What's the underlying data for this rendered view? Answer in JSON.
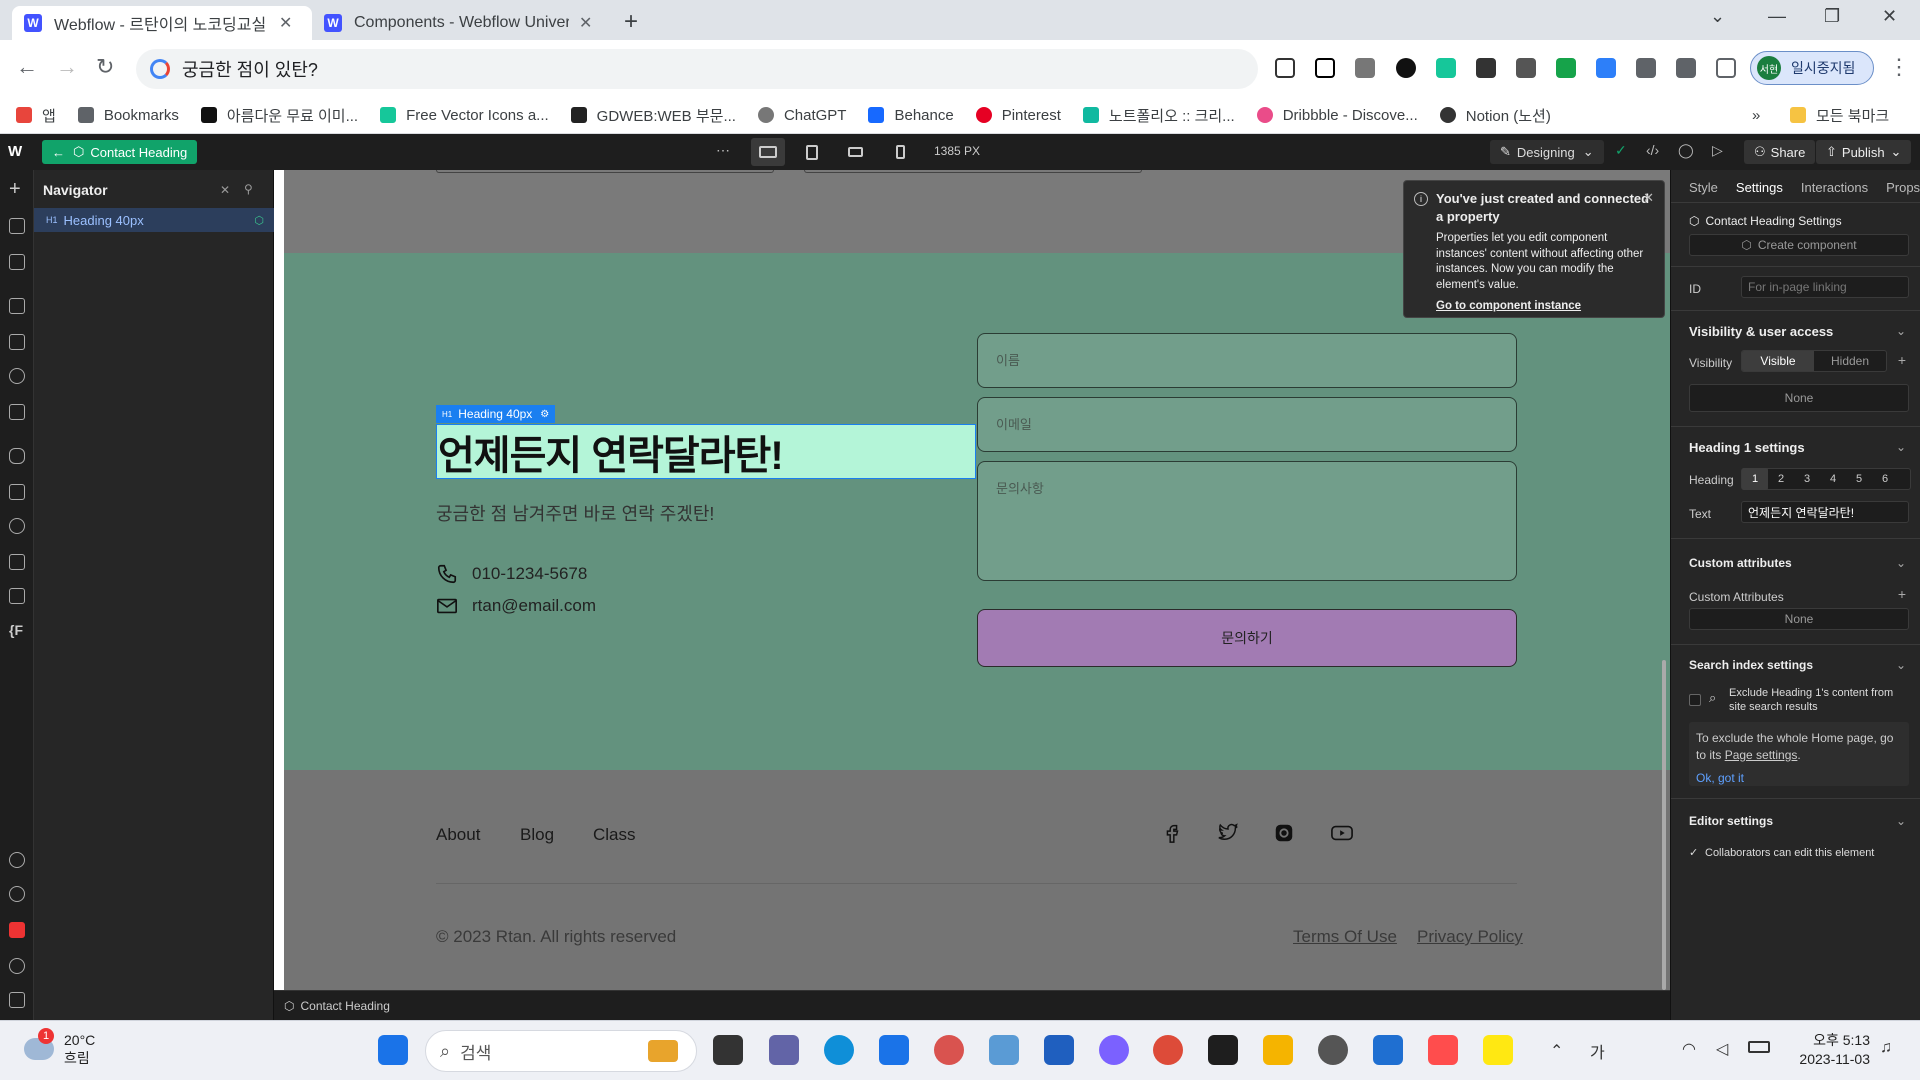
{
  "browser": {
    "tabs": [
      {
        "title": "Webflow - 르탄이의 노코딩교실",
        "active": true
      },
      {
        "title": "Components - Webflow Univer",
        "active": false
      }
    ],
    "address": "궁금한 점이 있탄?",
    "profile_label": "일시중지됨",
    "profile_avatar": "서현",
    "bookmarks": [
      {
        "label": "앱",
        "color": "#e8453c"
      },
      {
        "label": "Bookmarks",
        "color": "#5f6368"
      },
      {
        "label": "아름다운 무료 이미...",
        "color": "#111111"
      },
      {
        "label": "Free Vector Icons a...",
        "color": "#16c79a"
      },
      {
        "label": "GDWEB:WEB 부문...",
        "color": "#222222"
      },
      {
        "label": "ChatGPT",
        "color": "#777777"
      },
      {
        "label": "Behance",
        "color": "#1769ff"
      },
      {
        "label": "Pinterest",
        "color": "#e60023"
      },
      {
        "label": "노트폴리오 :: 크리...",
        "color": "#10b9a0"
      },
      {
        "label": "Dribbble - Discove...",
        "color": "#ea4c89"
      },
      {
        "label": "Notion (노션)",
        "color": "#333333"
      }
    ],
    "all_bookmarks": "모든 북마크"
  },
  "webflow": {
    "breadcrumb": "Contact Heading",
    "width_label": "1385 PX",
    "mode": "Designing",
    "share": "Share",
    "publish": "Publish",
    "navigator": {
      "title": "Navigator",
      "item_tag": "H1",
      "item_label": "Heading 40px"
    },
    "status_crumb": "Contact Heading"
  },
  "page": {
    "badge_tag": "H1",
    "badge_label": "Heading 40px",
    "heading": "언제든지 연락달라탄!",
    "subheading": "궁금한 점 남겨주면 바로 연락 주겠탄!",
    "phone": "010-1234-5678",
    "email": "rtan@email.com",
    "form": {
      "name_placeholder": "이름",
      "email_placeholder": "이메일",
      "message_placeholder": "문의사항",
      "submit": "문의하기"
    },
    "footer": {
      "links": [
        "About",
        "Blog",
        "Class"
      ],
      "copyright": "© 2023 Rtan. All rights reserved",
      "terms": "Terms Of Use",
      "privacy": "Privacy Policy"
    }
  },
  "popover": {
    "title": "You've just created and connected a property",
    "body": "Properties let you edit component instances' content without affecting other instances. Now you can modify the element's value.",
    "link": "Go to component instance"
  },
  "panel": {
    "tabs": [
      "Style",
      "Settings",
      "Interactions",
      "Props"
    ],
    "active_tab": "Settings",
    "settings_title": "Contact Heading Settings",
    "create_component": "Create component",
    "id_label": "ID",
    "id_placeholder": "For in-page linking",
    "visibility_section": "Visibility & user access",
    "visibility_label": "Visibility",
    "visible": "Visible",
    "hidden": "Hidden",
    "none": "None",
    "heading_section": "Heading 1 settings",
    "heading_label": "Heading",
    "heading_levels": [
      "1",
      "2",
      "3",
      "4",
      "5",
      "6"
    ],
    "text_label": "Text",
    "text_value": "언제든지 연락달라탄!",
    "custom_section": "Custom attributes",
    "custom_label": "Custom Attributes",
    "custom_none": "None",
    "search_section": "Search index settings",
    "exclude_text": "Exclude Heading 1's content from site search results",
    "hint_text": "To exclude the whole Home page, go to its",
    "hint_link": "Page settings",
    "hint_ok": "Ok, got it",
    "editor_section": "Editor settings",
    "collab_text": "Collaborators can edit this element"
  },
  "taskbar": {
    "temperature": "20°C",
    "weather": "흐림",
    "notification_count": "1",
    "search": "검색",
    "time": "오후 5:13",
    "date": "2023-11-03",
    "ime": "가"
  }
}
